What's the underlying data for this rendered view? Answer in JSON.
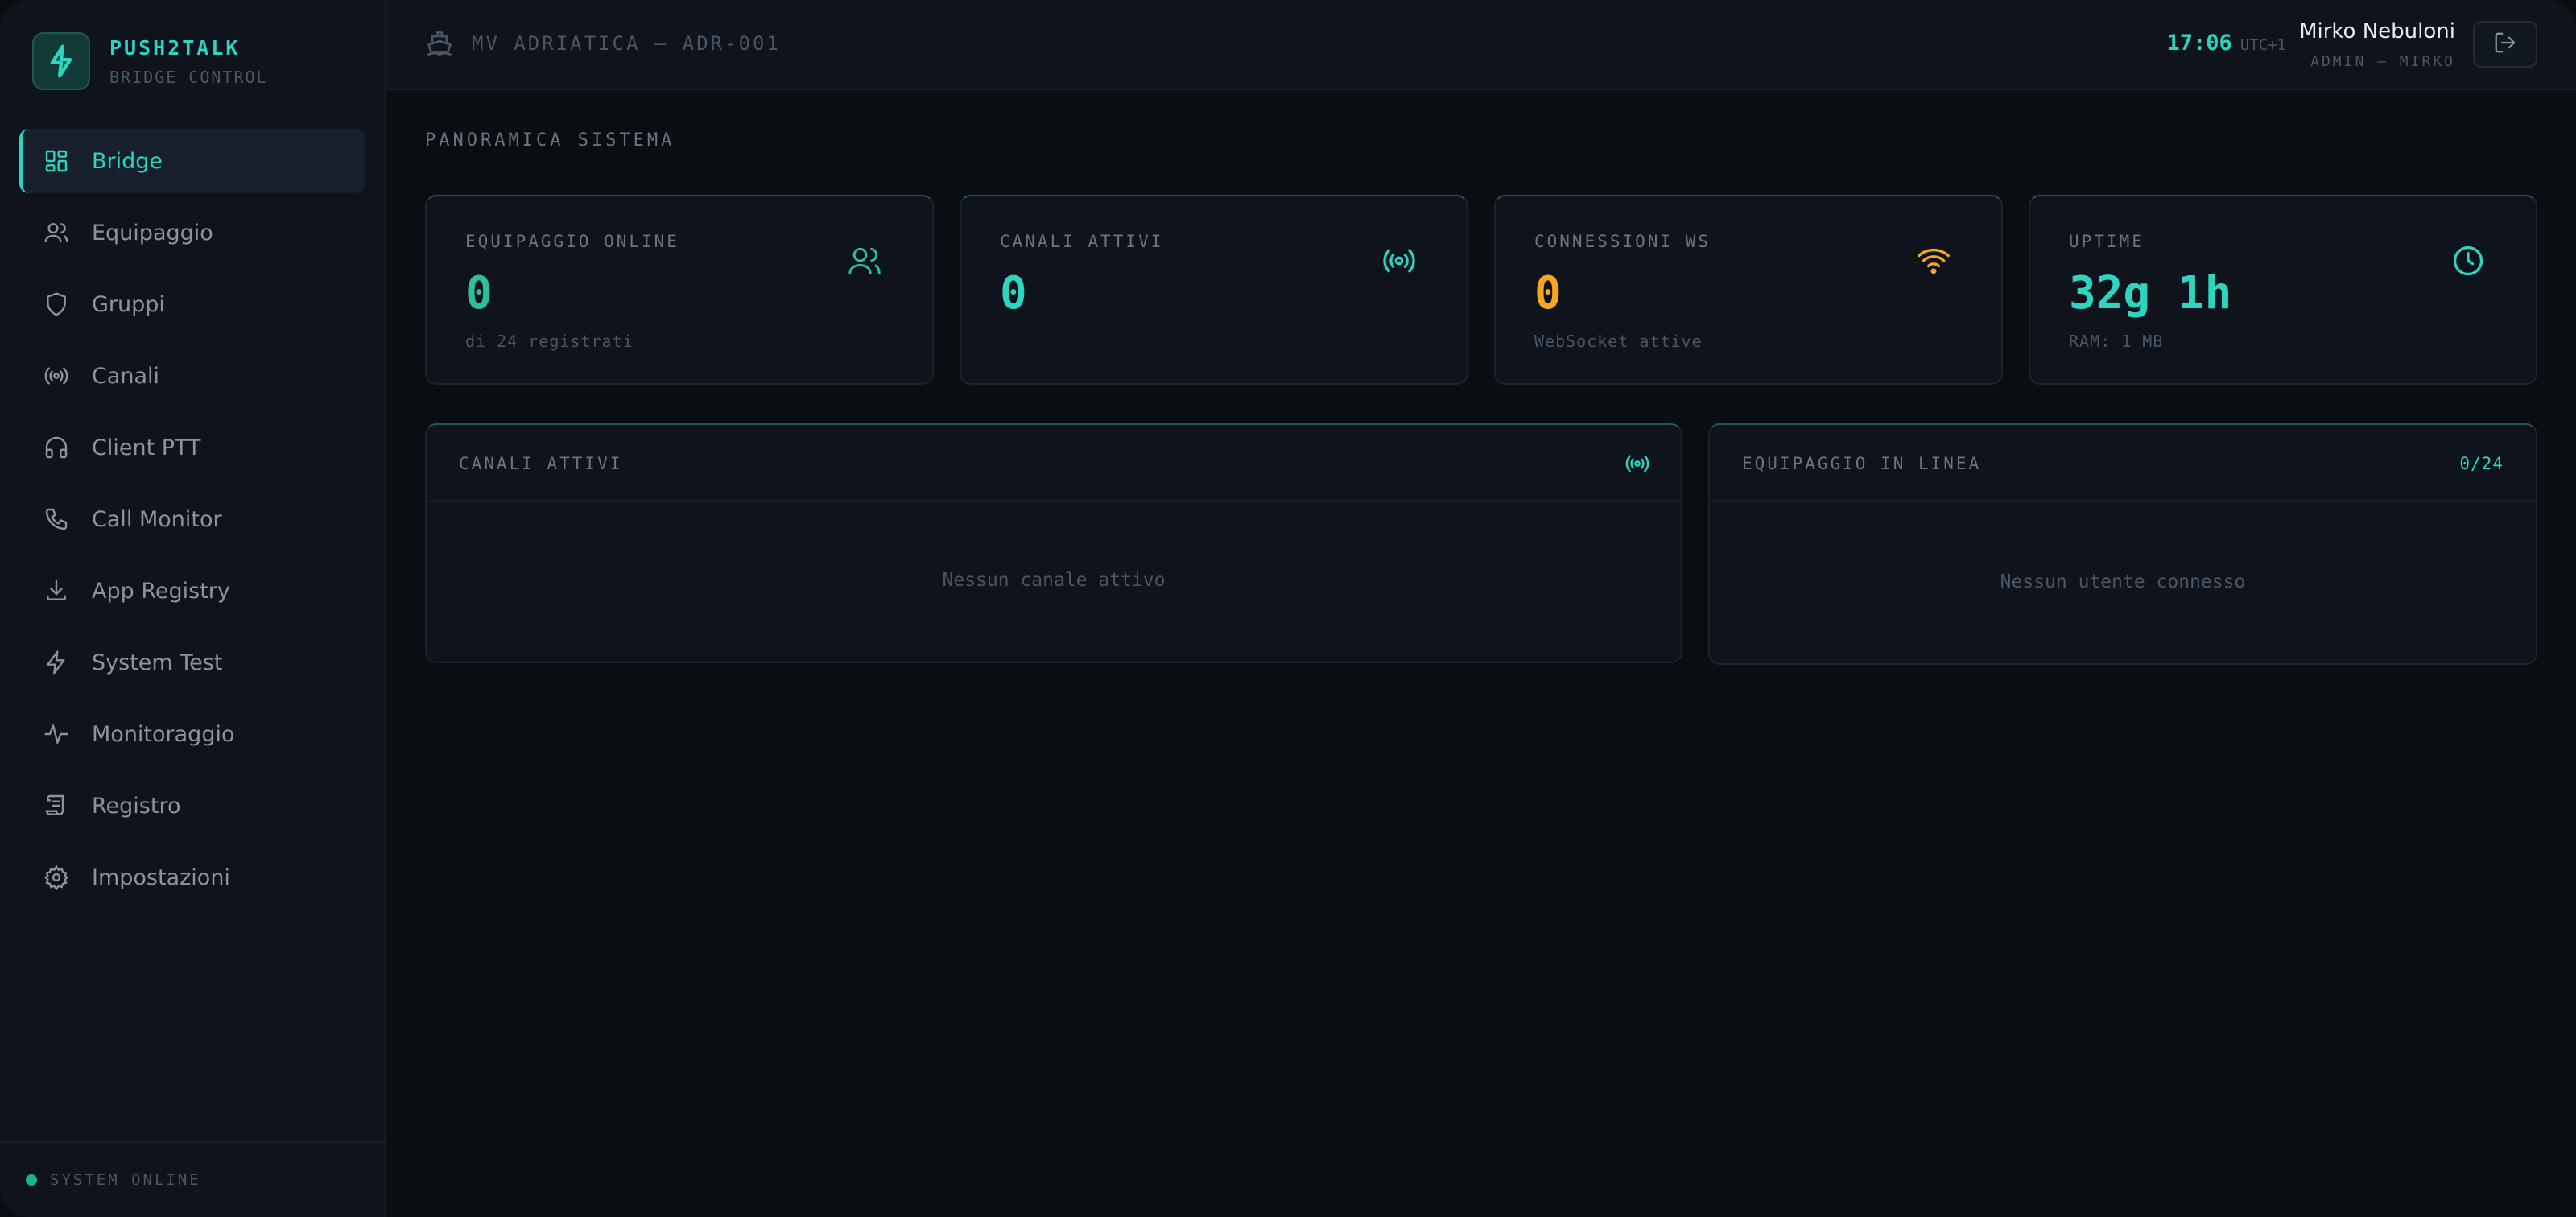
{
  "brand": {
    "name": "PUSH2TALK",
    "subtitle": "BRIDGE CONTROL"
  },
  "sidebar": {
    "items": [
      {
        "label": "Bridge",
        "icon": "dashboard-icon",
        "active": true
      },
      {
        "label": "Equipaggio",
        "icon": "users-icon"
      },
      {
        "label": "Gruppi",
        "icon": "shield-icon"
      },
      {
        "label": "Canali",
        "icon": "radio-icon"
      },
      {
        "label": "Client PTT",
        "icon": "headphones-icon"
      },
      {
        "label": "Call Monitor",
        "icon": "phone-icon"
      },
      {
        "label": "App Registry",
        "icon": "download-icon"
      },
      {
        "label": "System Test",
        "icon": "zap-icon"
      },
      {
        "label": "Monitoraggio",
        "icon": "activity-icon"
      },
      {
        "label": "Registro",
        "icon": "scroll-icon"
      },
      {
        "label": "Impostazioni",
        "icon": "gear-icon"
      }
    ],
    "status": "SYSTEM ONLINE"
  },
  "header": {
    "vessel": "MV ADRIATICA — ADR-001",
    "time": "17:06",
    "timezone": "UTC+1",
    "user_name": "Mirko Nebuloni",
    "user_role": "ADMIN — MIRKO"
  },
  "main": {
    "section_title": "PANORAMICA SISTEMA",
    "stats": [
      {
        "label": "EQUIPAGGIO ONLINE",
        "value": "0",
        "sub": "di 24 registrati",
        "icon": "users-icon",
        "color": "#2fbf95"
      },
      {
        "label": "CANALI ATTIVI",
        "value": "0",
        "sub": "",
        "icon": "radio-icon",
        "color": "#2dd4bf"
      },
      {
        "label": "CONNESSIONI WS",
        "value": "0",
        "sub": "WebSocket attive",
        "icon": "wifi-icon",
        "color": "#f5a524"
      },
      {
        "label": "UPTIME",
        "value": "32g 1h",
        "sub": "RAM: 1 MB",
        "icon": "clock-icon",
        "color": "#2dd4bf"
      }
    ],
    "panels": {
      "channels": {
        "title": "CANALI ATTIVI",
        "empty": "Nessun canale attivo"
      },
      "crew": {
        "title": "EQUIPAGGIO IN LINEA",
        "badge": "0/24",
        "empty": "Nessun utente connesso"
      }
    }
  },
  "colors": {
    "accent": "#2dd4bf",
    "warning": "#f5a524",
    "online": "#14b87f"
  }
}
